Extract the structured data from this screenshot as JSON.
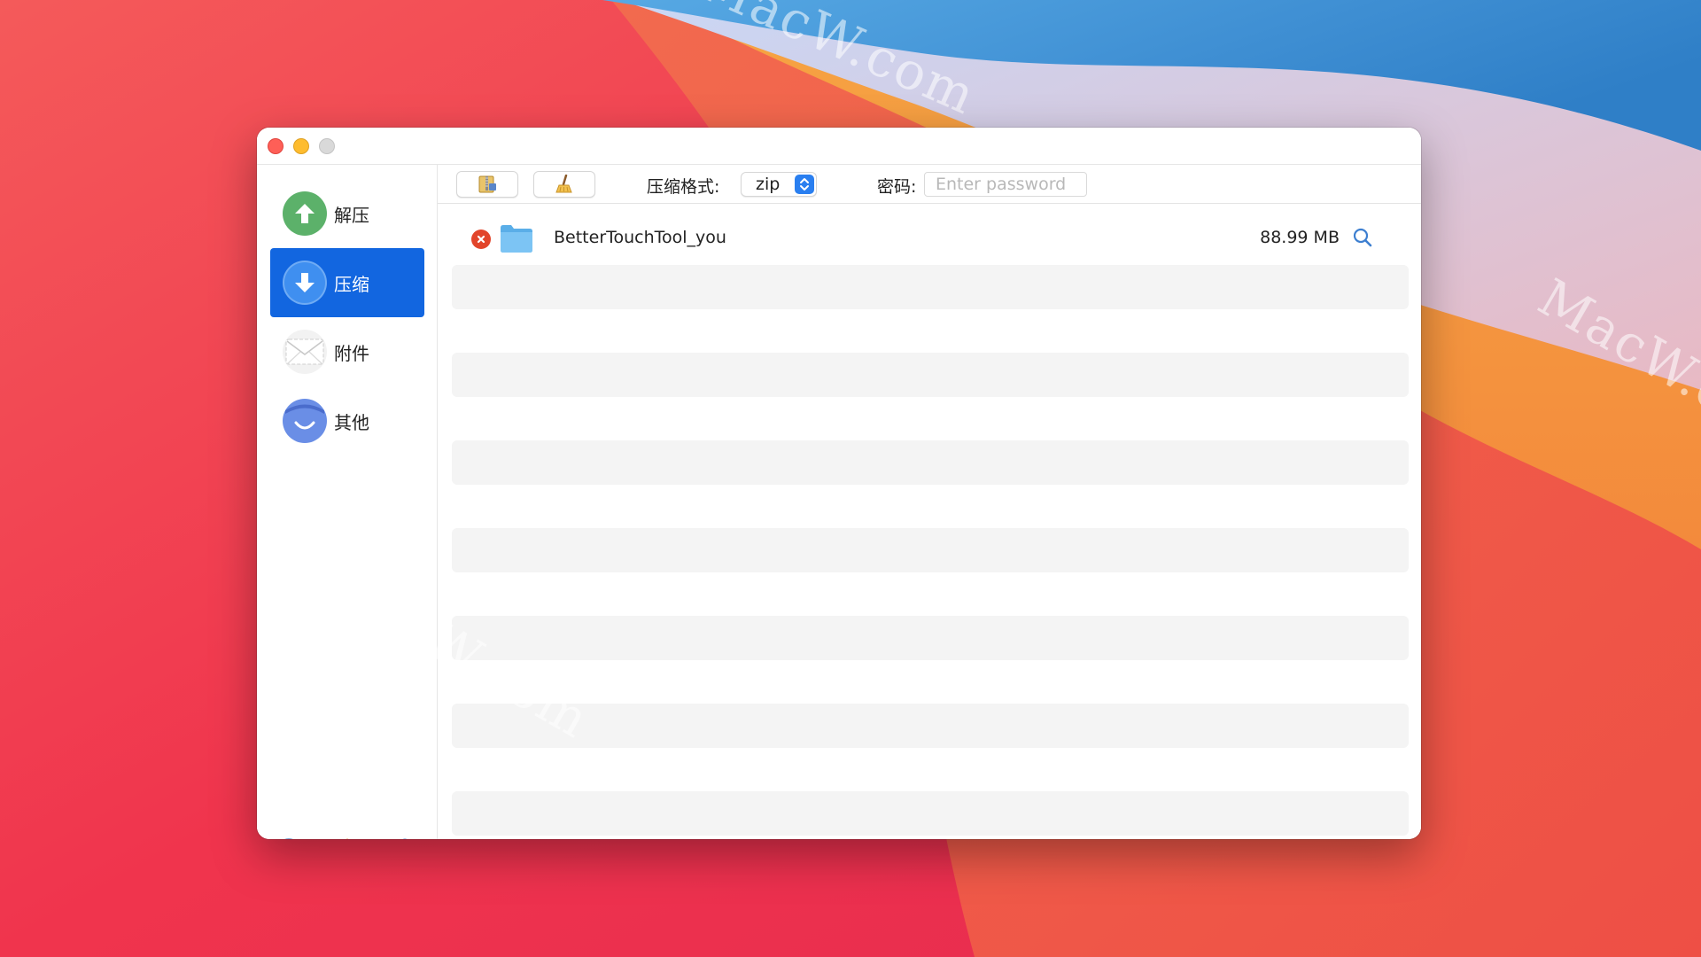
{
  "watermark": "MacW.com",
  "sidebar": {
    "items": [
      {
        "label": "解压",
        "icon": "arrow-up-icon"
      },
      {
        "label": "压缩",
        "icon": "arrow-down-icon",
        "selected": true
      },
      {
        "label": "附件",
        "icon": "envelope-icon"
      },
      {
        "label": "其他",
        "icon": "smile-icon"
      }
    ],
    "footer": [
      "help-icon",
      "star-icon",
      "gear-icon"
    ]
  },
  "toolbar": {
    "format_label": "压缩格式:",
    "format_value": "zip",
    "password_label": "密码:",
    "password_placeholder": "Enter password"
  },
  "files": [
    {
      "name": "BetterTouchTool_you",
      "size": "88.99 MB"
    }
  ],
  "colors": {
    "accent": "#1266e0",
    "remove": "#e2452b",
    "star": "#f08c1a"
  }
}
